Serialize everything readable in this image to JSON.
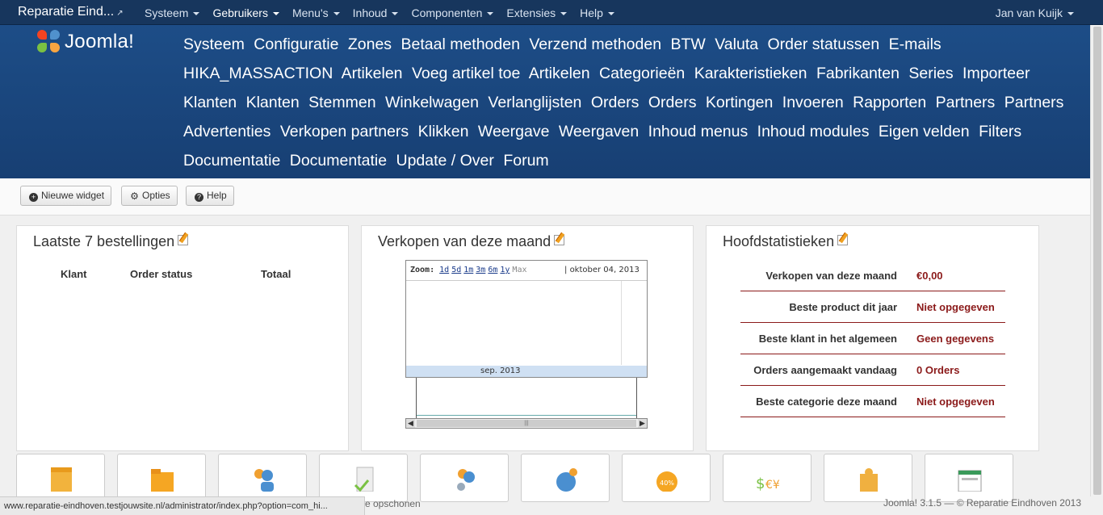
{
  "navbar": {
    "site_name": "Reparatie Eind...",
    "menu": [
      "Systeem",
      "Gebruikers",
      "Menu's",
      "Inhoud",
      "Componenten",
      "Extensies",
      "Help"
    ],
    "user": "Jan van Kuijk"
  },
  "logo": {
    "text": "Joomla!"
  },
  "quicklinks": [
    "Systeem",
    "Configuratie",
    "Zones",
    "Betaal methoden",
    "Verzend methoden",
    "BTW",
    "Valuta",
    "Order statussen",
    "E-mails",
    "HIKA_MASSACTION",
    "Artikelen",
    "Voeg artikel toe",
    "Artikelen",
    "Categorieën",
    "Karakteristieken",
    "Fabrikanten",
    "Series",
    "Importeer",
    "Klanten",
    "Klanten",
    "Stemmen",
    "Winkelwagen",
    "Verlanglijsten",
    "Orders",
    "Orders",
    "Kortingen",
    "Invoeren",
    "Rapporten",
    "Partners",
    "Partners",
    "Advertenties",
    "Verkopen partners",
    "Klikken",
    "Weergave",
    "Weergaven",
    "Inhoud menus",
    "Inhoud modules",
    "Eigen velden",
    "Filters",
    "Documentatie",
    "Documentatie",
    "Update / Over",
    "Forum"
  ],
  "toolbar": {
    "new_widget": "Nieuwe widget",
    "options": "Opties",
    "help": "Help"
  },
  "orders_panel": {
    "title": "Laatste 7 bestellingen",
    "columns": [
      "Klant",
      "Order status",
      "Totaal"
    ]
  },
  "sales_panel": {
    "title": "Verkopen van deze maand",
    "zoom_label": "Zoom:",
    "zoom_options": [
      "1d",
      "5d",
      "1m",
      "3m",
      "6m",
      "1y"
    ],
    "zoom_disabled": "Max",
    "date": "oktober 04, 2013",
    "axis_label": "sep. 2013"
  },
  "stats_panel": {
    "title": "Hoofdstatistieken",
    "rows": [
      {
        "label": "Verkopen van deze maand",
        "value": "€0,00"
      },
      {
        "label": "Beste product dit jaar",
        "value": "Niet opgegeven"
      },
      {
        "label": "Beste klant in het algemeen",
        "value": "Geen gegevens"
      },
      {
        "label": "Orders aangemaakt vandaag",
        "value": "0 Orders"
      },
      {
        "label": "Beste categorie deze maand",
        "value": "Niet opgegeven"
      }
    ]
  },
  "status_url": "www.reparatie-eindhoven.testjouwsite.nl/administrator/index.php?option=com_hi...",
  "footer_partial": "e opschonen",
  "footer": "Joomla! 3.1.5 — © Reparatie Eindhoven 2013",
  "colors": {
    "navbar": "#17365d",
    "header": "#1d4d87",
    "stat_value": "#8b1a1a"
  }
}
